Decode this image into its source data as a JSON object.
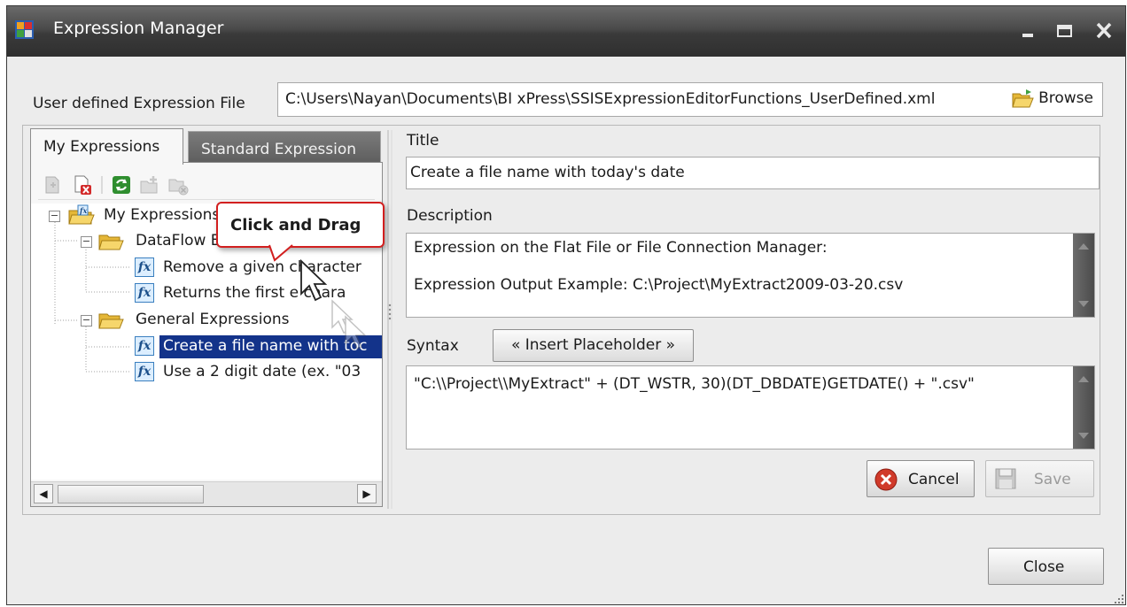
{
  "window": {
    "title": "Expression Manager"
  },
  "file": {
    "label": "User defined Expression File",
    "path": "C:\\Users\\Nayan\\Documents\\BI xPress\\SSISExpressionEditorFunctions_UserDefined.xml",
    "browse_label": "Browse"
  },
  "tabs": [
    {
      "label": "My Expressions",
      "active": true
    },
    {
      "label": "Standard Expression",
      "active": false
    }
  ],
  "tree": {
    "root": "My Expressions",
    "groups": [
      {
        "label": "DataFlow E",
        "items": [
          "Remove a given character",
          "Returns the first  e chara"
        ]
      },
      {
        "label": "General Expressions",
        "items": [
          "Create a file name with toc",
          "Use a 2 digit date (ex. \"03"
        ]
      }
    ],
    "selected": "Create a file name with toc"
  },
  "callout": {
    "text": "Click and Drag"
  },
  "editor": {
    "title_label": "Title",
    "title_value": "Create a file name with today's date",
    "description_label": "Description",
    "description_lines": [
      "Expression on the Flat File or File Connection Manager:",
      "Expression Output Example: C:\\Project\\MyExtract2009-03-20.csv"
    ],
    "syntax_label": "Syntax",
    "insert_placeholder_label": "« Insert Placeholder »",
    "syntax_value": "\"C:\\\\Project\\\\MyExtract\" + (DT_WSTR, 30)(DT_DBDATE)GETDATE() + \".csv\""
  },
  "buttons": {
    "cancel": "Cancel",
    "save": "Save",
    "close": "Close"
  },
  "colors": {
    "selection": "#13338a",
    "callout_border": "#d21f1f",
    "titlebar": "#3a3a3a"
  }
}
